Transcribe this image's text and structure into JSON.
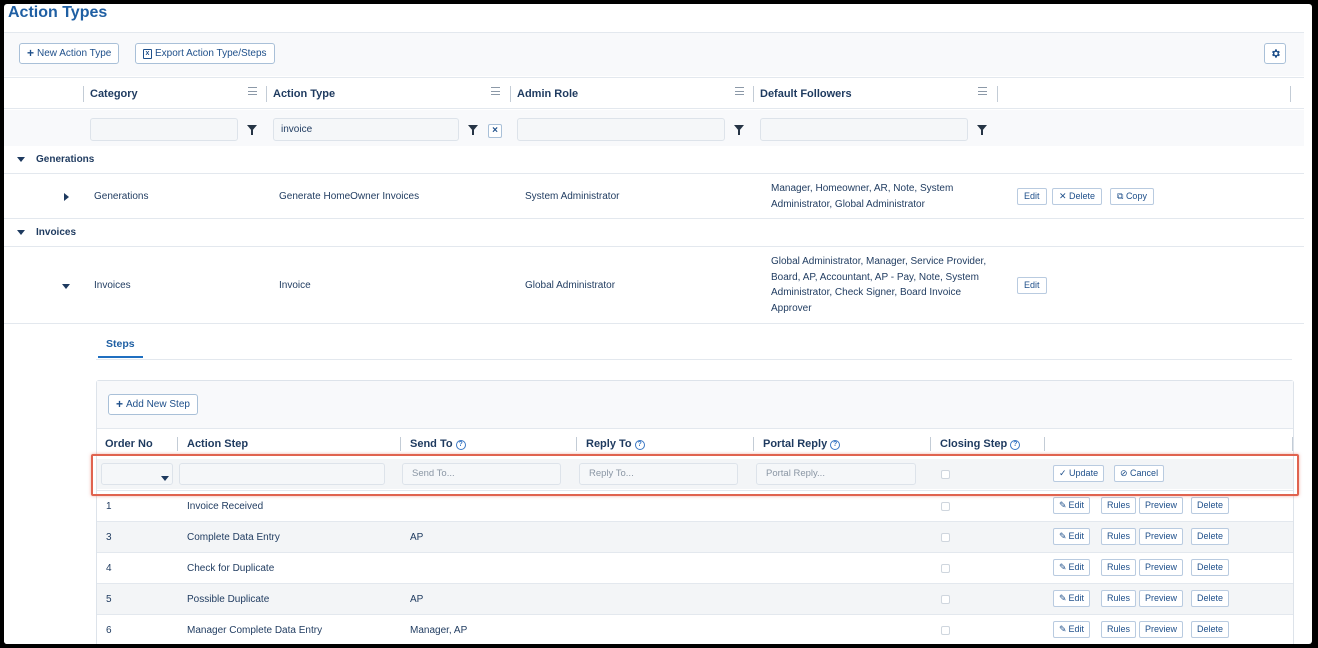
{
  "page_title": "Action Types",
  "toolbar": {
    "new_action_type": "New Action Type",
    "export": "Export Action Type/Steps"
  },
  "columns": {
    "category": "Category",
    "action_type": "Action Type",
    "admin_role": "Admin Role",
    "default_followers": "Default Followers"
  },
  "filters": {
    "category": "",
    "action_type": "invoice",
    "admin_role": "",
    "default_followers": ""
  },
  "groups": [
    {
      "name": "Generations",
      "row": {
        "category": "Generations",
        "action_type": "Generate HomeOwner Invoices",
        "admin_role": "System Administrator",
        "followers": "Manager, Homeowner, AR, Note, System Administrator, Global Administrator",
        "edit": "Edit",
        "delete": "Delete",
        "copy": "Copy"
      }
    },
    {
      "name": "Invoices",
      "row": {
        "category": "Invoices",
        "action_type": "Invoice",
        "admin_role": "Global Administrator",
        "followers": "Global Administrator, Manager, Service Provider, Board, AP, Accountant, AP - Pay, Note, System Administrator, Check Signer, Board Invoice Approver",
        "edit": "Edit"
      }
    }
  ],
  "steps": {
    "tab_label": "Steps",
    "add_new_step": "Add New Step",
    "columns": {
      "order_no": "Order No",
      "action_step": "Action Step",
      "send_to": "Send To",
      "reply_to": "Reply To",
      "portal_reply": "Portal Reply",
      "closing_step": "Closing Step"
    },
    "edit_row": {
      "send_to_placeholder": "Send To...",
      "reply_to_placeholder": "Reply To...",
      "portal_reply_placeholder": "Portal Reply...",
      "update": "Update",
      "cancel": "Cancel"
    },
    "row_buttons": {
      "edit": "Edit",
      "rules": "Rules",
      "preview": "Preview",
      "delete": "Delete"
    },
    "rows": [
      {
        "order": "1",
        "step": "Invoice Received",
        "send_to": ""
      },
      {
        "order": "3",
        "step": "Complete Data Entry",
        "send_to": "AP"
      },
      {
        "order": "4",
        "step": "Check for Duplicate",
        "send_to": ""
      },
      {
        "order": "5",
        "step": "Possible Duplicate",
        "send_to": "AP"
      },
      {
        "order": "6",
        "step": "Manager Complete Data Entry",
        "send_to": "Manager, AP"
      }
    ]
  },
  "colors": {
    "accent": "#1f5fa3",
    "highlight_border": "#e0634f"
  },
  "icons": {
    "settings": "gear-icon",
    "filter": "funnel-icon",
    "export": "excel-icon"
  }
}
